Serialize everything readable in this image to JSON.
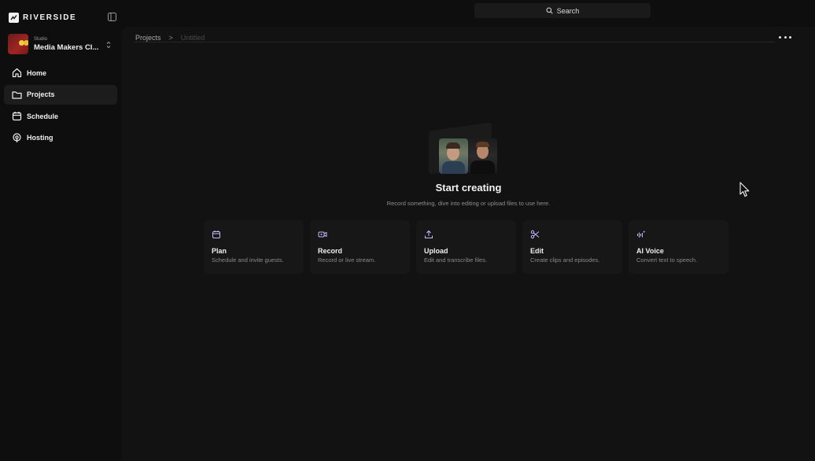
{
  "app": {
    "brand": "RIVERSIDE"
  },
  "studio": {
    "caption": "Studio",
    "name": "Media Makers Cl..."
  },
  "sidebar": {
    "items": [
      {
        "label": "Home",
        "icon": "home-icon",
        "active": false
      },
      {
        "label": "Projects",
        "icon": "folder-icon",
        "active": true
      },
      {
        "label": "Schedule",
        "icon": "calendar-icon",
        "active": false
      },
      {
        "label": "Hosting",
        "icon": "podcast-icon",
        "active": false
      }
    ]
  },
  "search": {
    "label": "Search"
  },
  "breadcrumb": {
    "root": "Projects",
    "separator": ">",
    "current": "Untitled"
  },
  "empty_state": {
    "title": "Start creating",
    "subtitle": "Record something, dive into editing or upload files to use here."
  },
  "cards": [
    {
      "title": "Plan",
      "desc": "Schedule and invite guests.",
      "icon": "calendar-icon"
    },
    {
      "title": "Record",
      "desc": "Record or live stream.",
      "icon": "video-camera-icon"
    },
    {
      "title": "Upload",
      "desc": "Edit and transcribe files.",
      "icon": "upload-icon"
    },
    {
      "title": "Edit",
      "desc": "Create clips and episodes.",
      "icon": "scissors-icon"
    },
    {
      "title": "AI Voice",
      "desc": "Convert text to speech.",
      "icon": "ai-voice-icon"
    }
  ],
  "colors": {
    "background": "#0e0e0e",
    "panel": "#121212",
    "card": "#171717",
    "accent": "#c9b8ff"
  }
}
